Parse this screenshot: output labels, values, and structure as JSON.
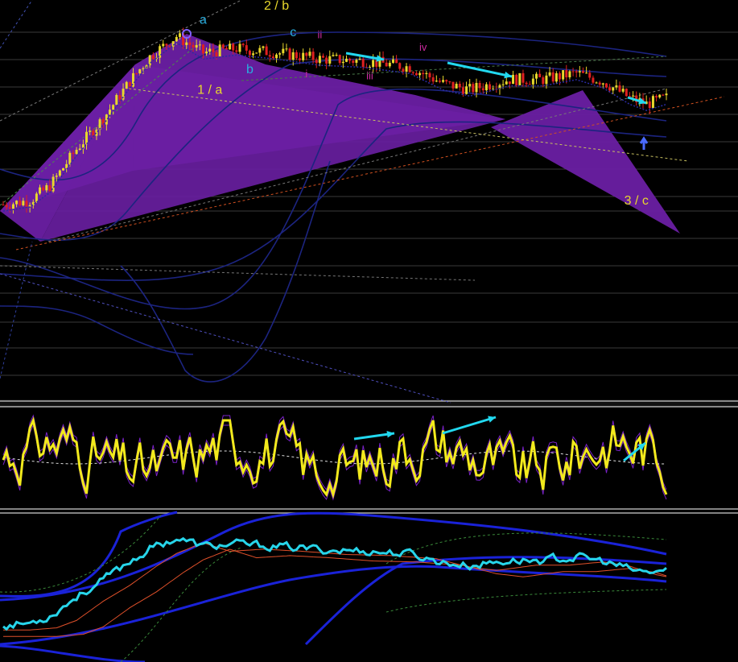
{
  "chart_data": [
    {
      "type": "candlestick",
      "panel": "price",
      "title": "",
      "xlabel": "",
      "ylabel": "",
      "grid": true,
      "n_bars": 200,
      "close_path": [
        {
          "i": 0,
          "v": 0.18
        },
        {
          "i": 8,
          "v": 0.2
        },
        {
          "i": 14,
          "v": 0.27
        },
        {
          "i": 22,
          "v": 0.45
        },
        {
          "i": 30,
          "v": 0.6
        },
        {
          "i": 38,
          "v": 0.78
        },
        {
          "i": 44,
          "v": 0.9
        },
        {
          "i": 52,
          "v": 1.0
        },
        {
          "i": 60,
          "v": 0.92
        },
        {
          "i": 70,
          "v": 0.94
        },
        {
          "i": 82,
          "v": 0.92
        },
        {
          "i": 95,
          "v": 0.89
        },
        {
          "i": 108,
          "v": 0.88
        },
        {
          "i": 122,
          "v": 0.85
        },
        {
          "i": 132,
          "v": 0.77
        },
        {
          "i": 140,
          "v": 0.74
        },
        {
          "i": 152,
          "v": 0.79
        },
        {
          "i": 162,
          "v": 0.79
        },
        {
          "i": 172,
          "v": 0.82
        },
        {
          "i": 180,
          "v": 0.78
        },
        {
          "i": 188,
          "v": 0.7
        },
        {
          "i": 193,
          "v": 0.67
        },
        {
          "i": 199,
          "v": 0.7
        }
      ],
      "wave_labels": [
        {
          "text": "a",
          "i": 60,
          "v": 1.06,
          "color": "#29aee0"
        },
        {
          "text": "2 / b",
          "i": 82,
          "v": 1.13,
          "color": "#e8d82c"
        },
        {
          "text": "c",
          "i": 87,
          "v": 1.0,
          "color": "#29aee0"
        },
        {
          "text": "ii",
          "i": 95,
          "v": 0.99,
          "color": "#cc2aa0"
        },
        {
          "text": "iv",
          "i": 126,
          "v": 0.93,
          "color": "#cc2aa0"
        },
        {
          "text": "b",
          "i": 74,
          "v": 0.82,
          "color": "#29aee0"
        },
        {
          "text": "i",
          "i": 91,
          "v": 0.8,
          "color": "#cc2aa0"
        },
        {
          "text": "iii",
          "i": 110,
          "v": 0.79,
          "color": "#cc2aa0"
        },
        {
          "text": "1 / a",
          "i": 62,
          "v": 0.72,
          "color": "#e8d82c"
        },
        {
          "text": "3 / c",
          "i": 190,
          "v": 0.18,
          "color": "#e8d82c"
        }
      ],
      "colors": {
        "up": "#e8d82c",
        "down": "#e02020",
        "pattern": "#6a1fa3",
        "arrow": "#22d8ef",
        "bands": "#1c2480"
      }
    },
    {
      "type": "line",
      "panel": "oscillator",
      "series": [],
      "grid": false,
      "colors": {
        "main": "#f2ea1c",
        "envelope": "#7a22c8",
        "signal": "#e0e0e0"
      }
    },
    {
      "type": "line",
      "panel": "indicator",
      "series": [],
      "grid": false,
      "colors": {
        "main": "#27d5ea",
        "channel": "#1a22d8",
        "ma": "#e0502a"
      }
    }
  ]
}
